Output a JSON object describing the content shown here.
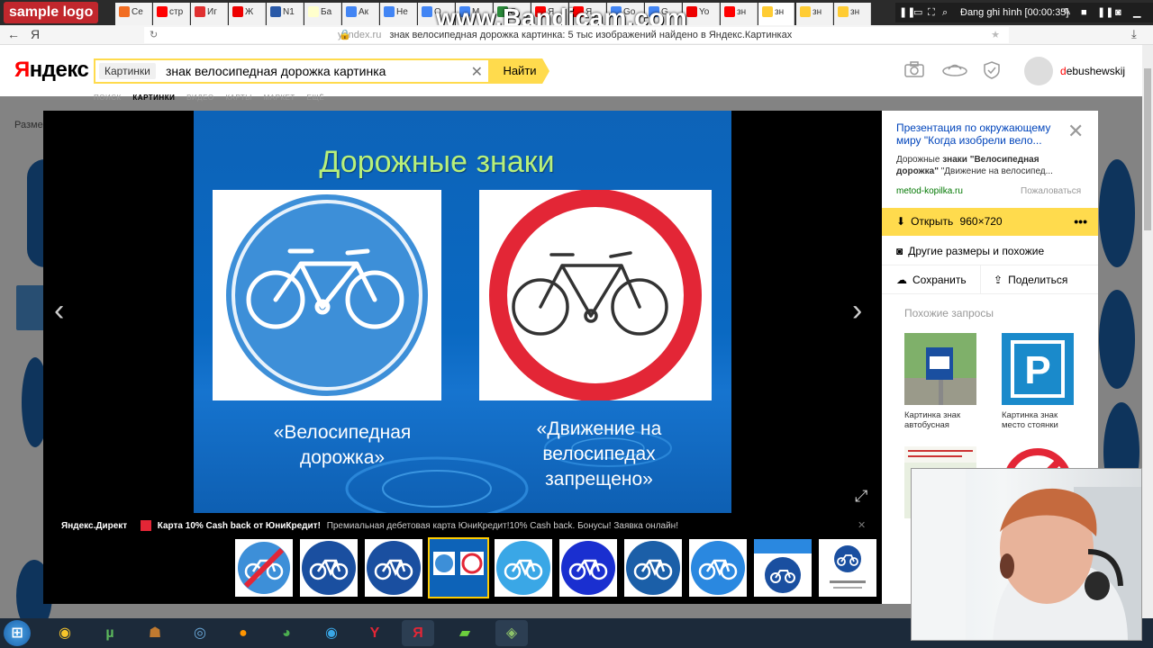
{
  "overlay": {
    "sample_logo": "sample logo",
    "watermark": "www.Bandicam.com",
    "recording_status": "Đang ghi hình [00:00:35]"
  },
  "tabs": [
    {
      "label": "Ce",
      "color": "#f26d21"
    },
    {
      "label": "стр",
      "color": "#f00"
    },
    {
      "label": "Иг",
      "color": "#e03030"
    },
    {
      "label": "Ж",
      "color": "#e00"
    },
    {
      "label": "N1",
      "color": "#2a5aa8"
    },
    {
      "label": "Ба",
      "color": "#ffc"
    },
    {
      "label": "Ак",
      "color": "#4285f4"
    },
    {
      "label": "Не",
      "color": "#4285f4"
    },
    {
      "label": "Q",
      "color": "#4285f4"
    },
    {
      "label": "M",
      "color": "#4285f4"
    },
    {
      "label": "C",
      "color": "#2a8a3a"
    },
    {
      "label": "Я",
      "color": "#f00"
    },
    {
      "label": "Я",
      "color": "#f00"
    },
    {
      "label": "Go",
      "color": "#4285f4"
    },
    {
      "label": "G",
      "color": "#4285f4"
    },
    {
      "label": "Yo",
      "color": "#e00"
    },
    {
      "label": "зн",
      "color": "#f00"
    },
    {
      "label": "зн",
      "color": "#fc3"
    },
    {
      "label": "зн",
      "color": "#fc3"
    },
    {
      "label": "зн",
      "color": "#fc3"
    }
  ],
  "address": {
    "host": "yandex.ru",
    "title": "знак велосипедная дорожка картинка: 5 тыс изображений найдено в Яндекс.Картинках"
  },
  "header": {
    "logo_first": "Я",
    "logo_rest": "ндекс",
    "search_tag": "Картинки",
    "search_query": "знак велосипедная дорожка картинка",
    "search_button": "Найти",
    "user_first": "d",
    "user_rest": "ebushewskij",
    "nav": [
      "ПОИСК",
      "КАРТИНКИ",
      "ВИДЕО",
      "КАРТЫ",
      "МАРКЕТ",
      "ЕЩЁ"
    ],
    "sizes_label": "Размер"
  },
  "slide": {
    "title": "Дорожные знаки",
    "caption_left": [
      "«Велосипедная",
      "дорожка»"
    ],
    "caption_right": [
      "«Движение на",
      "велосипедах",
      "запрещено»"
    ]
  },
  "ad": {
    "label": "Яндекс.Директ",
    "title": "Карта 10% Cash back от ЮниКредит!",
    "text": "Премиальная дебетовая карта ЮниКредит!10% Cash back. Бонусы! Заявка онлайн!"
  },
  "panel": {
    "title": "Презентация по окружающему миру \"Когда изобрели вело...",
    "desc_pre": "Дорожные ",
    "desc_bold": "знаки \"Велосипедная дорожка\"",
    "desc_post": " \"Движение на велосипед...",
    "site": "metod-kopilka.ru",
    "report": "Пожаловаться",
    "open": "Открыть",
    "open_size": "960×720",
    "more": "•••",
    "other_sizes": "Другие размеры и похожие",
    "save": "Сохранить",
    "share": "Поделиться",
    "similar_heading": "Похожие запросы",
    "similar": [
      {
        "caption": "Картинка знак автобусная"
      },
      {
        "caption": "Картинка знак место стоянки"
      }
    ]
  },
  "colors": {
    "yandex_yellow": "#ffdb4d",
    "sign_blue": "#3d8fd8",
    "prohibit_red": "#e32636",
    "link_blue": "#0044bb"
  }
}
